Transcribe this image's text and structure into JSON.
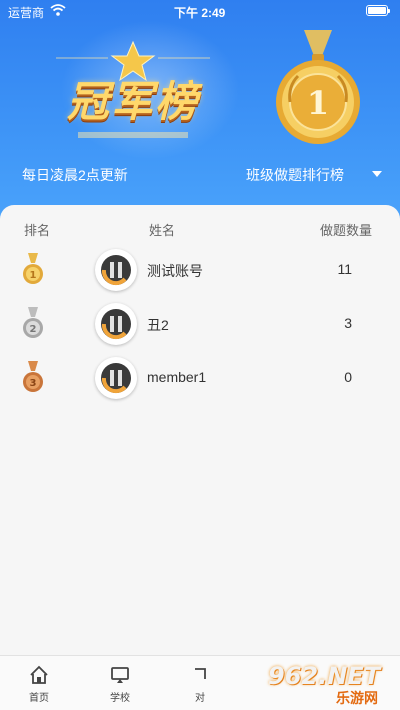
{
  "status_bar": {
    "carrier": "运营商",
    "time": "下午 2:49"
  },
  "header": {
    "banner_title": "冠军榜",
    "banner_medal_number": "1",
    "update_note": "每日凌晨2点更新",
    "selector_label": "班级做题排行榜"
  },
  "table": {
    "columns": {
      "rank": "排名",
      "name": "姓名",
      "count": "做题数量"
    },
    "rows": [
      {
        "rank_medal": "gold-medal-icon",
        "name": "测试账号",
        "count": "11"
      },
      {
        "rank_medal": "silver-medal-icon",
        "name": "丑2",
        "count": "3"
      },
      {
        "rank_medal": "bronze-medal-icon",
        "name": "member1",
        "count": "0"
      }
    ]
  },
  "tabbar": {
    "items": [
      {
        "label": "首页",
        "icon": "home-icon"
      },
      {
        "label": "学校",
        "icon": "school-icon"
      },
      {
        "label": "对",
        "icon": "match-icon"
      }
    ]
  },
  "watermark": {
    "number": "962.NET",
    "text": "乐游网"
  },
  "colors": {
    "header_blue": "#3d93f6",
    "gold": "#e2a93a",
    "silver": "#a8a8a8",
    "bronze": "#c9753a"
  }
}
